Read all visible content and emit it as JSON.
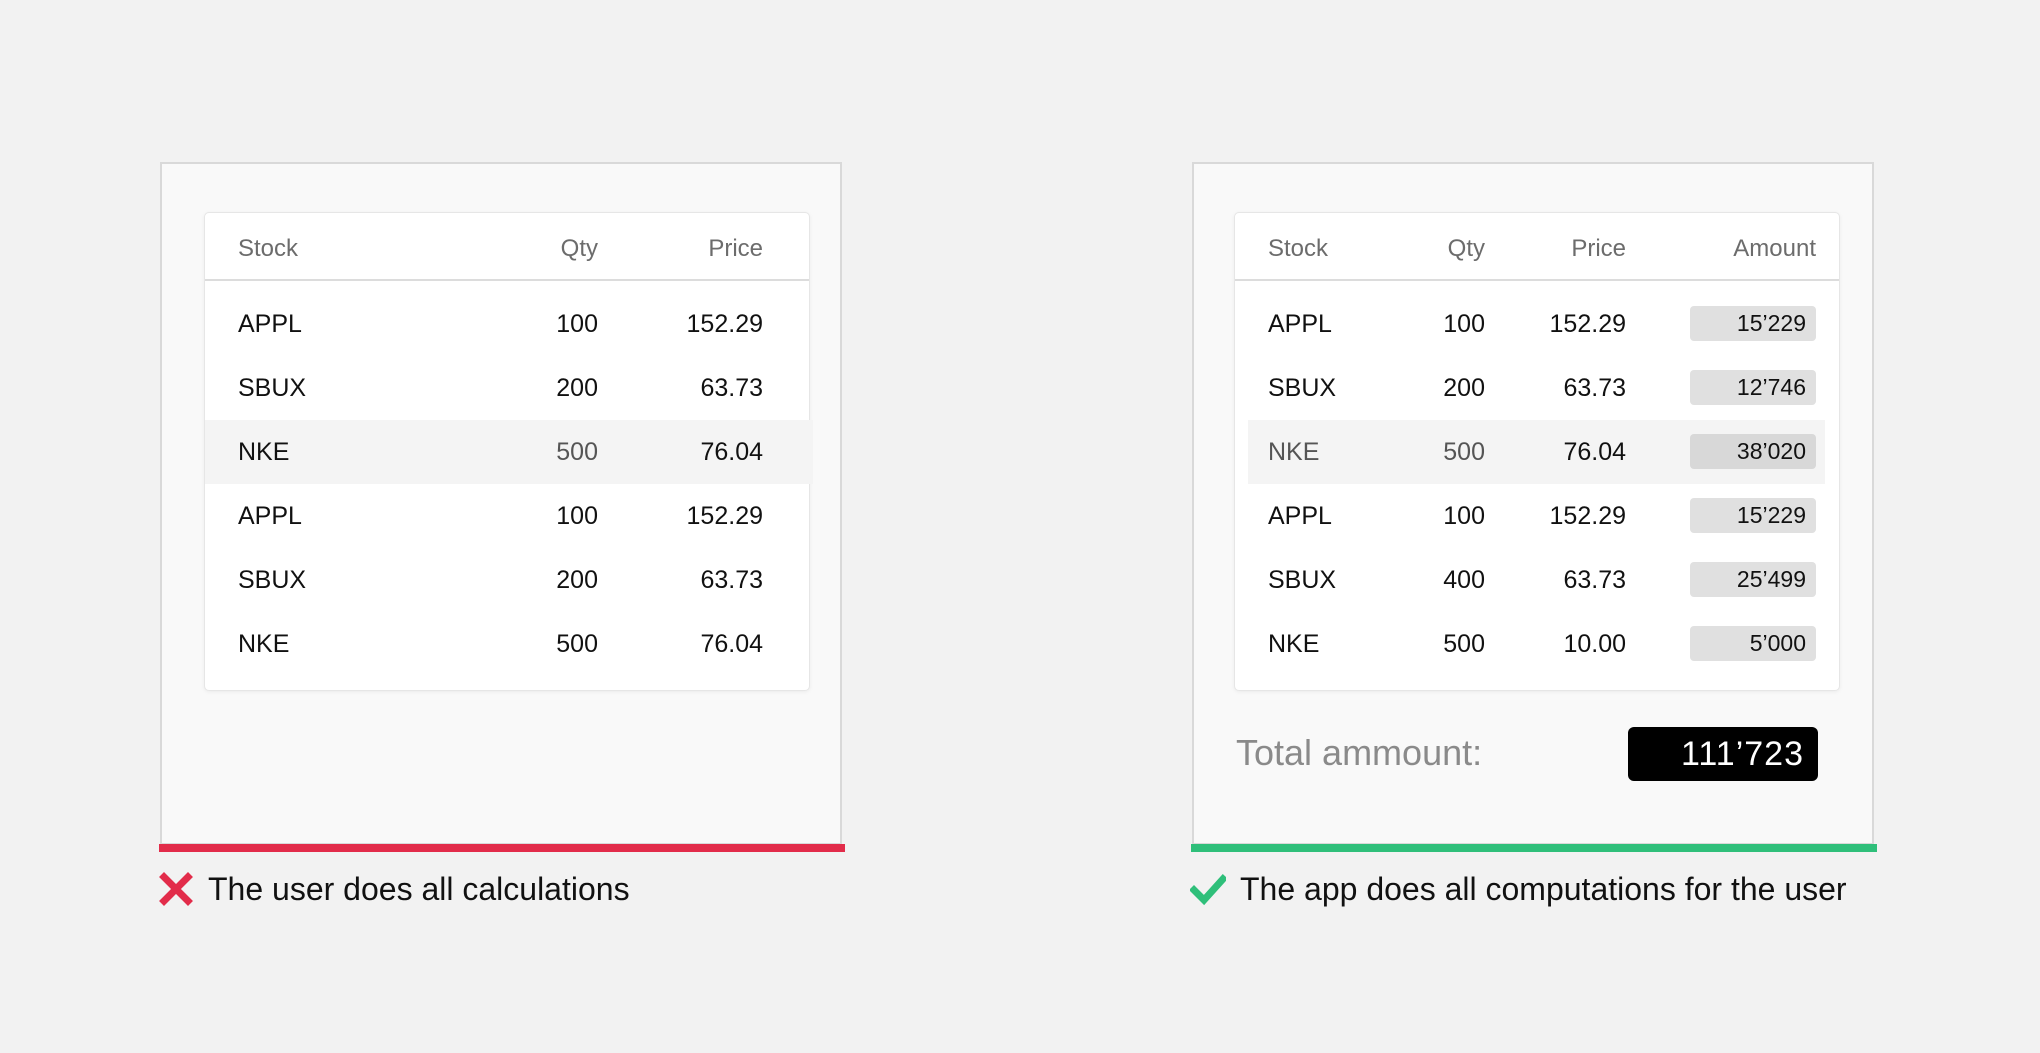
{
  "left": {
    "headers": {
      "stock": "Stock",
      "qty": "Qty",
      "price": "Price"
    },
    "rows": [
      {
        "stock": "APPL",
        "qty": "100",
        "price": "152.29"
      },
      {
        "stock": "SBUX",
        "qty": "200",
        "price": "63.73"
      },
      {
        "stock": "NKE",
        "qty": "500",
        "price": "76.04"
      },
      {
        "stock": "APPL",
        "qty": "100",
        "price": "152.29"
      },
      {
        "stock": "SBUX",
        "qty": "200",
        "price": "63.73"
      },
      {
        "stock": "NKE",
        "qty": "500",
        "price": "76.04"
      }
    ],
    "caption": "The user does all calculations",
    "caption_icon": "x-mark-icon",
    "accent_color": "#e22c4a"
  },
  "right": {
    "headers": {
      "stock": "Stock",
      "qty": "Qty",
      "price": "Price",
      "amount": "Amount"
    },
    "rows": [
      {
        "stock": "APPL",
        "qty": "100",
        "price": "152.29",
        "amount": "15’229"
      },
      {
        "stock": "SBUX",
        "qty": "200",
        "price": "63.73",
        "amount": "12’746"
      },
      {
        "stock": "NKE",
        "qty": "500",
        "price": "76.04",
        "amount": "38’020"
      },
      {
        "stock": "APPL",
        "qty": "100",
        "price": "152.29",
        "amount": "15’229"
      },
      {
        "stock": "SBUX",
        "qty": "400",
        "price": "63.73",
        "amount": "25’499"
      },
      {
        "stock": "NKE",
        "qty": "500",
        "price": "10.00",
        "amount": "5’000"
      }
    ],
    "total_label": "Total ammount:",
    "total_value": "111’723",
    "caption": "The app does all computations for the user",
    "caption_icon": "check-mark-icon",
    "accent_color": "#2fbf7a"
  }
}
